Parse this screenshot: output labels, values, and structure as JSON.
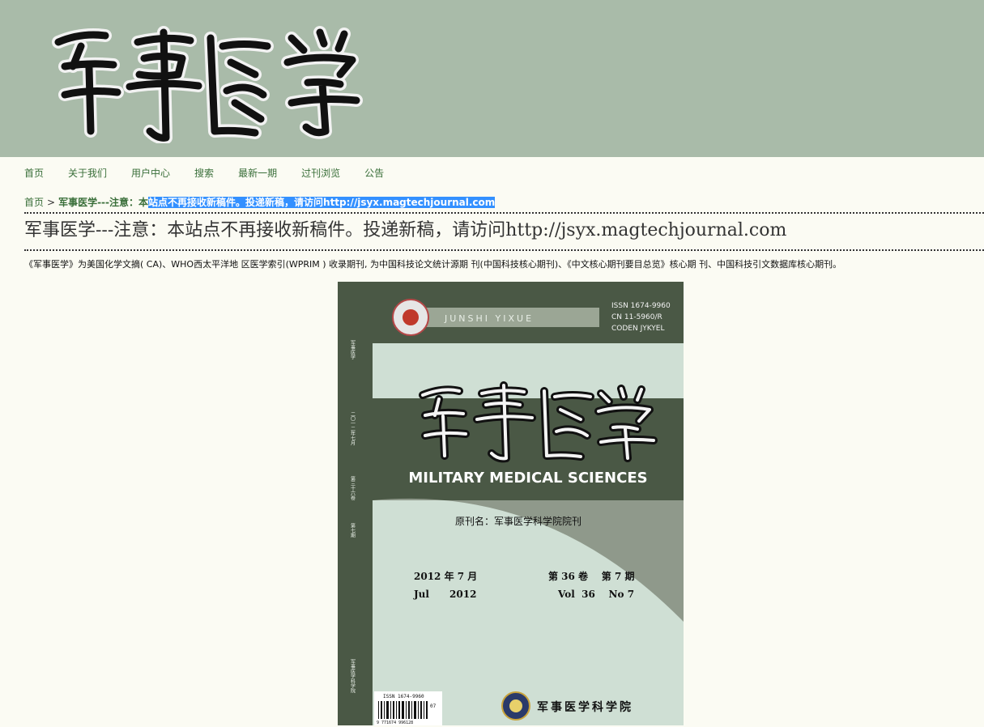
{
  "site": {
    "logo_alt": "军事医学"
  },
  "nav": {
    "items": [
      "首页",
      "关于我们",
      "用户中心",
      "搜索",
      "最新一期",
      "过刊浏览",
      "公告"
    ]
  },
  "breadcrumb": {
    "home": "首页",
    "sep": ">",
    "current_prefix": "军事医学---注意：本",
    "current_selected": "站点不再接收新稿件。投递新稿，请访问http://jsyx.magtechjournal.com"
  },
  "page": {
    "title": "军事医学---注意：本站点不再接收新稿件。投递新稿，请访问http://jsyx.magtechjournal.com",
    "description": "《军事医学》为美国化学文摘( CA)、WHO西太平洋地 区医学索引(WPRIM ) 收录期刊, 为中国科技论文统计源期 刊(中国科技核心期刊)、《中文核心期刊要目总览》核心期 刊、中国科技引文数据库核心期刊。"
  },
  "cover": {
    "pinyin": "JUNSHI YIXUE",
    "issn": "ISSN 1674-9960",
    "cn": "CN 11-5960/R",
    "coden": "CODEN JYKYEL",
    "title_cn": "军事医学",
    "title_en": "MILITARY MEDICAL SCIENCES",
    "original_name": "原刊名：军事医学科学院院刊",
    "date_cn": "2012 年 7 月",
    "date_en": "Jul      2012",
    "vol_cn": "第 36 卷    第 7 期",
    "vol_en": "Vol  36    No 7",
    "publisher": "军事医学科学院",
    "barcode_issn": "ISSN 1674-9960",
    "barcode_number": "9 771674 996128",
    "barcode_suffix": "07",
    "spine_top": "军事医学",
    "spine_date": "二〇一二年七月",
    "spine_vol": "第三十六卷",
    "spine_no": "第七期",
    "spine_publisher": "军事医学科学院",
    "colors": {
      "dark": "#4a5845",
      "light": "#cfdfd4",
      "mid": "#8f998b",
      "band": "#9ba695"
    }
  }
}
